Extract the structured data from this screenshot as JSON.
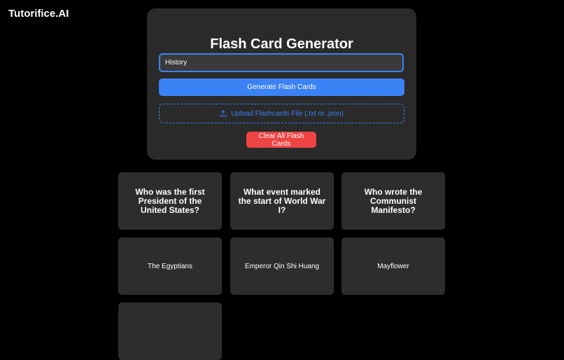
{
  "header": {
    "brand": "Tutorifice.AI"
  },
  "generator": {
    "title": "Flash Card Generator",
    "input_value": "History",
    "generate_label": "Generate Flash Cards",
    "upload_label": "Upload Flashcards File (.txt or .json)",
    "upload_icon": "upload-icon",
    "clear_label": "Clear All Flash Cards"
  },
  "cards": [
    {
      "text": "Who was the first President of the United States?",
      "kind": "question"
    },
    {
      "text": "What event marked the start of World War I?",
      "kind": "question"
    },
    {
      "text": "Who wrote the Communist Manifesto?",
      "kind": "question"
    },
    {
      "text": "The Egyptians",
      "kind": "answer"
    },
    {
      "text": "Emperor Qin Shi Huang",
      "kind": "answer"
    },
    {
      "text": "Mayflower",
      "kind": "answer"
    },
    {
      "text": "",
      "kind": "partial"
    }
  ],
  "colors": {
    "background": "#000000",
    "panel": "#2a2a2a",
    "card": "#2d2d2d",
    "accent": "#3b82f6",
    "danger": "#ef4444"
  }
}
